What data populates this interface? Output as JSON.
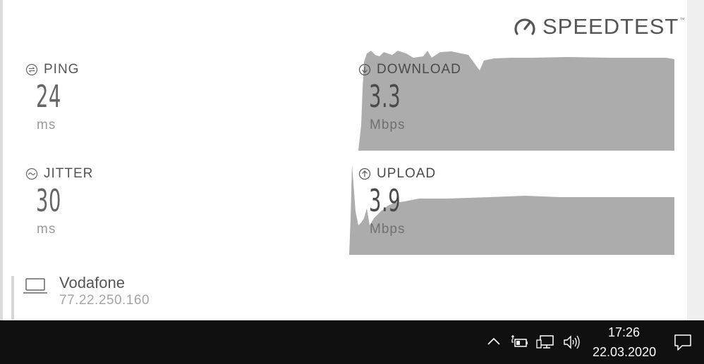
{
  "app": {
    "logo_text": "SPEEDTEST",
    "logo_tm": "™"
  },
  "metrics": {
    "ping": {
      "label": "PING",
      "value": "24",
      "unit": "ms"
    },
    "jitter": {
      "label": "JITTER",
      "value": "30",
      "unit": "ms"
    },
    "download": {
      "label": "DOWNLOAD",
      "value": "3.3",
      "unit": "Mbps"
    },
    "upload": {
      "label": "UPLOAD",
      "value": "3.9",
      "unit": "Mbps"
    }
  },
  "provider": {
    "name": "Vodafone",
    "ip": "77.22.250.160"
  },
  "taskbar": {
    "time": "17:26",
    "date": "22.03.2020",
    "tray_icons": [
      "chevron-up-icon",
      "battery-charging-icon",
      "network-icon",
      "volume-icon",
      "notification-icon"
    ]
  },
  "colors": {
    "graph_fill": "#acacac",
    "taskbar": "#101010",
    "panel": "#ffffff"
  }
}
